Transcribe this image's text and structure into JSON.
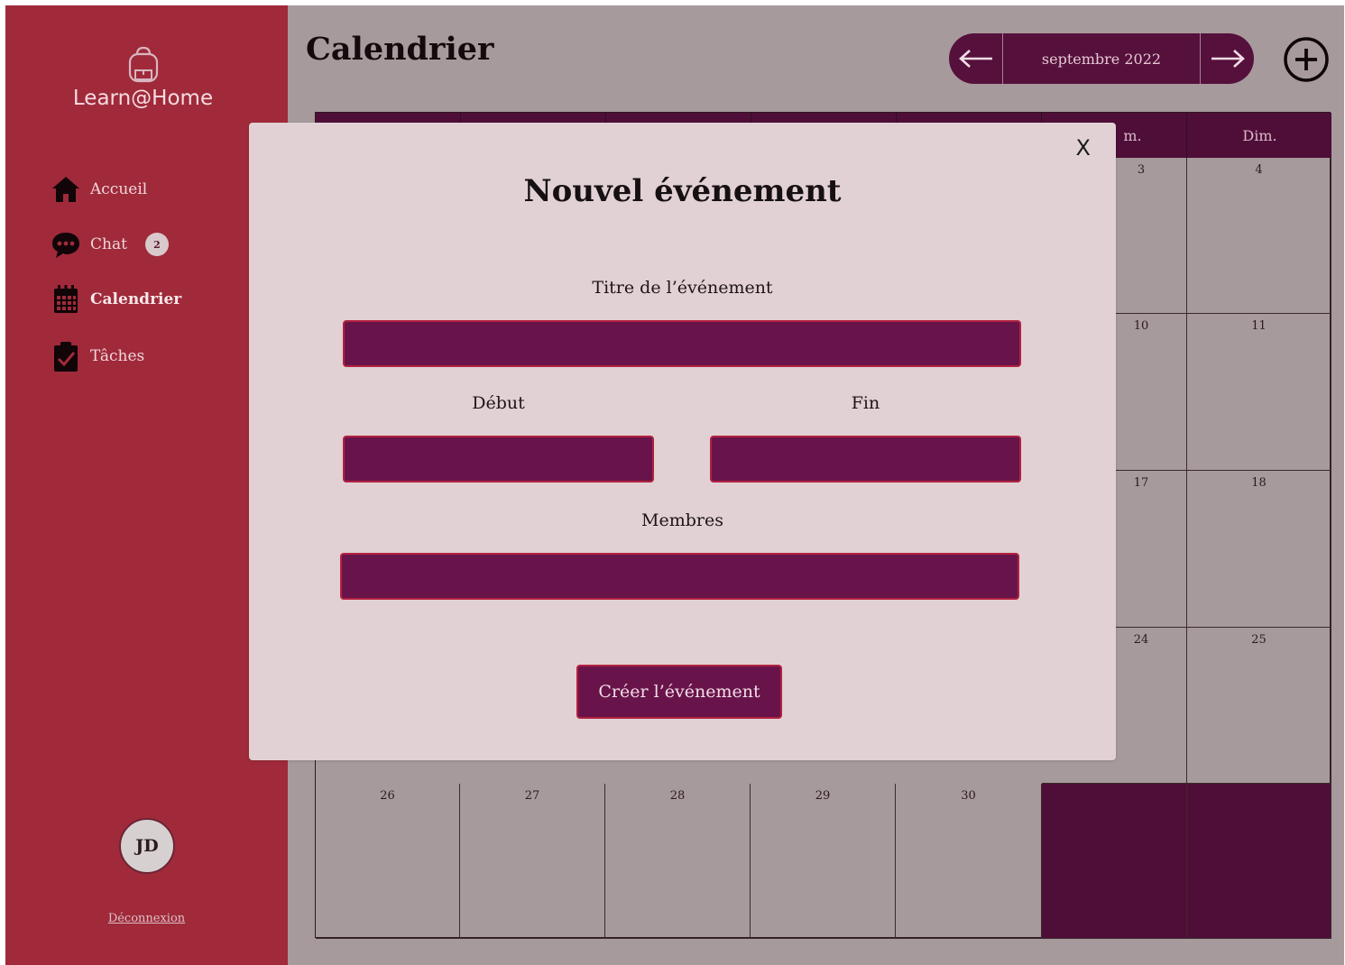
{
  "app": {
    "name": "Learn@Home"
  },
  "sidebar": {
    "items": [
      {
        "label": "Accueil",
        "icon": "home-icon"
      },
      {
        "label": "Chat",
        "icon": "chat-bubble-icon",
        "badge": "2"
      },
      {
        "label": "Calendrier",
        "icon": "calendar-icon",
        "active": true
      },
      {
        "label": "Tâches",
        "icon": "clipboard-check-icon"
      }
    ],
    "user_initials": "JD",
    "logout_label": "Déconnexion"
  },
  "header": {
    "title": "Calendrier",
    "month_label": "septembre 2022",
    "prev_icon": "arrow-left-icon",
    "next_icon": "arrow-right-icon",
    "add_icon": "plus-circle-icon"
  },
  "calendar": {
    "visible_day_headers": {
      "sat_partial": "m.",
      "sun": "Dim."
    },
    "visible_numbers": {
      "sat_row1": "3",
      "sun_row1": "4",
      "sat_row2": "10",
      "sun_row2": "11",
      "sat_row3": "17",
      "sun_row3": "18",
      "sat_row4": "24",
      "sun_row4": "25",
      "last_row": [
        "26",
        "27",
        "28",
        "29",
        "30"
      ]
    }
  },
  "modal": {
    "close_label": "X",
    "title": "Nouvel événement",
    "title_field_label": "Titre de l’événement",
    "start_label": "Début",
    "end_label": "Fin",
    "members_label": "Membres",
    "title_value": "",
    "start_value": "",
    "end_value": "",
    "members_value": "",
    "submit_label": "Créer l’événement"
  },
  "colors": {
    "sidebar_bg": "#a02a3a",
    "main_bg": "#a69a9c",
    "accent_dark": "#4f0e38",
    "input_bg": "#68144a",
    "input_border": "#b2213f",
    "modal_bg": "#e1d1d4"
  }
}
